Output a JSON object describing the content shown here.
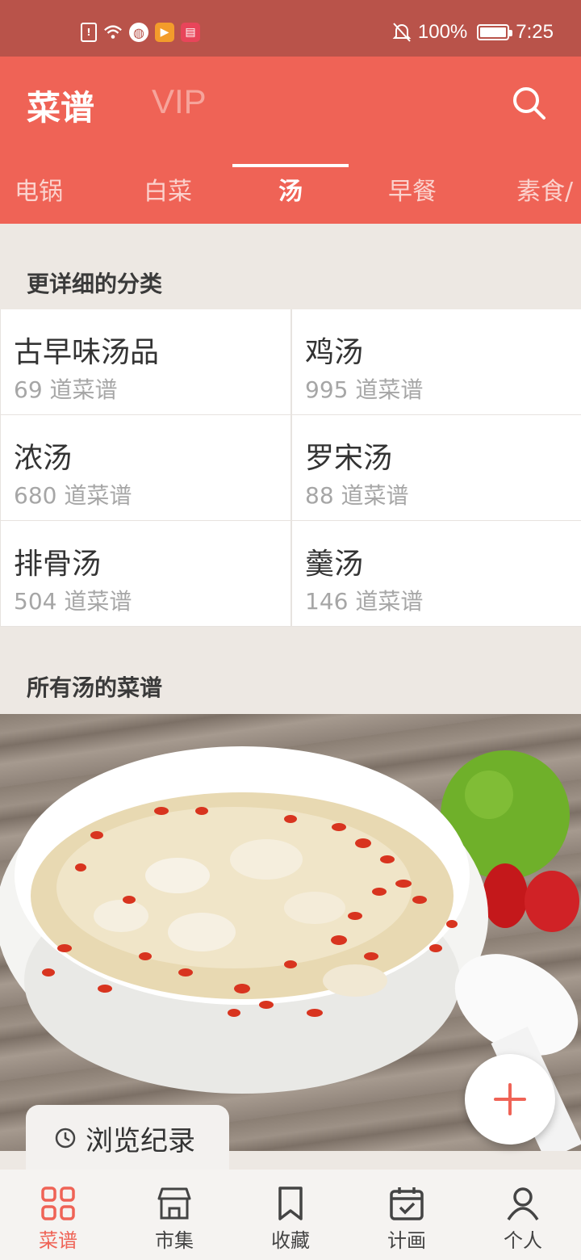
{
  "status_bar": {
    "battery": "100%",
    "time": "7:25",
    "left_icons": [
      "sim-alert-icon",
      "wifi-icon",
      "browser-icon",
      "video-app-icon",
      "reader-app-icon"
    ]
  },
  "header": {
    "title": "菜谱",
    "vip": "VIP",
    "search_icon": "search-icon"
  },
  "tabs": [
    {
      "label": "电锅",
      "active": false
    },
    {
      "label": "白菜",
      "active": false
    },
    {
      "label": "汤",
      "active": true
    },
    {
      "label": "早餐",
      "active": false
    },
    {
      "label": "素食/",
      "active": false
    }
  ],
  "detail_section": {
    "title": "更详细的分类",
    "categories": [
      {
        "name": "古早味汤品",
        "count": "69 道菜谱"
      },
      {
        "name": "鸡汤",
        "count": "995 道菜谱"
      },
      {
        "name": "浓汤",
        "count": "680 道菜谱"
      },
      {
        "name": "罗宋汤",
        "count": "88 道菜谱"
      },
      {
        "name": "排骨汤",
        "count": "504 道菜谱"
      },
      {
        "name": "羹汤",
        "count": "146 道菜谱"
      }
    ]
  },
  "all_section": {
    "title": "所有汤的菜谱"
  },
  "history": {
    "label": "浏览纪录",
    "icon": "history-clock-icon"
  },
  "fab": {
    "icon": "plus-icon"
  },
  "bottom_nav": [
    {
      "label": "菜谱",
      "icon": "grid-icon",
      "active": true
    },
    {
      "label": "市集",
      "icon": "shop-icon",
      "active": false
    },
    {
      "label": "收藏",
      "icon": "bookmark-icon",
      "active": false
    },
    {
      "label": "计画",
      "icon": "calendar-icon",
      "active": false
    },
    {
      "label": "个人",
      "icon": "person-icon",
      "active": false
    }
  ],
  "colors": {
    "status_bar": "#b9534a",
    "brand": "#ef6356",
    "background": "#ede8e3"
  }
}
